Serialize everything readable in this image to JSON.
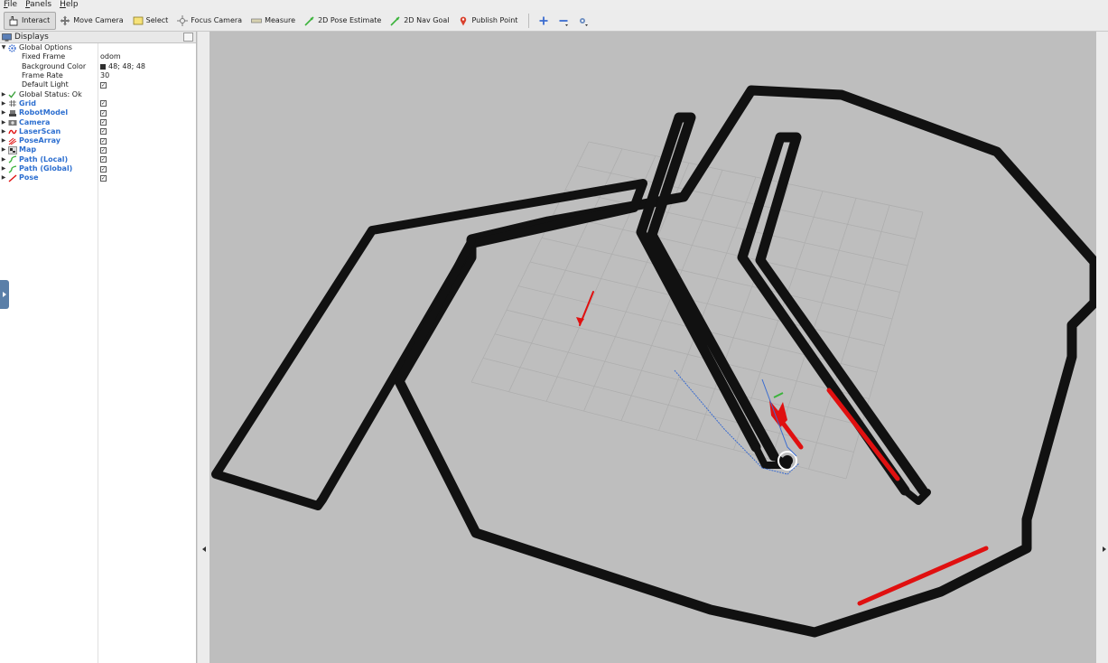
{
  "menubar": {
    "items": [
      "File",
      "Panels",
      "Help"
    ]
  },
  "toolbar": {
    "tools": [
      {
        "label": "Interact",
        "icon": "cursor-hand-icon",
        "active": true
      },
      {
        "label": "Move Camera",
        "icon": "move-camera-icon"
      },
      {
        "label": "Select",
        "icon": "select-box-icon"
      },
      {
        "label": "Focus Camera",
        "icon": "focus-camera-icon"
      },
      {
        "label": "Measure",
        "icon": "ruler-icon"
      },
      {
        "label": "2D Pose Estimate",
        "icon": "green-arrow-icon"
      },
      {
        "label": "2D Nav Goal",
        "icon": "green-arrow-icon"
      },
      {
        "label": "Publish Point",
        "icon": "map-pin-icon"
      }
    ],
    "view_controls": [
      "add-tool-icon",
      "remove-tool-icon",
      "camera-view-icon"
    ]
  },
  "displays": {
    "title": "Displays",
    "global_options": {
      "label": "Global Options",
      "fixed_frame": {
        "label": "Fixed Frame",
        "value": "odom"
      },
      "background_color": {
        "label": "Background Color",
        "value": "48; 48; 48"
      },
      "frame_rate": {
        "label": "Frame Rate",
        "value": "30"
      },
      "default_light": {
        "label": "Default Light",
        "checked": true
      }
    },
    "global_status": {
      "label": "Global Status: Ok"
    },
    "plugins": [
      {
        "label": "Grid",
        "checked": true,
        "icon": "grid-icon"
      },
      {
        "label": "RobotModel",
        "checked": true,
        "icon": "robot-icon"
      },
      {
        "label": "Camera",
        "checked": true,
        "icon": "camera-icon"
      },
      {
        "label": "LaserScan",
        "checked": true,
        "icon": "laser-scan-icon"
      },
      {
        "label": "PoseArray",
        "checked": true,
        "icon": "pose-array-icon"
      },
      {
        "label": "Map",
        "checked": true,
        "icon": "map-icon"
      },
      {
        "label": "Path (Local)",
        "checked": true,
        "icon": "path-icon"
      },
      {
        "label": "Path (Global)",
        "checked": true,
        "icon": "path-icon"
      },
      {
        "label": "Pose",
        "checked": true,
        "icon": "pose-arrow-icon"
      }
    ]
  },
  "viewport": {
    "background": "#bebebe",
    "map_color": "#111111",
    "grid_color": "#a9a9a9",
    "laser_color": "#e01010",
    "path_color": "#3a6cd0"
  }
}
